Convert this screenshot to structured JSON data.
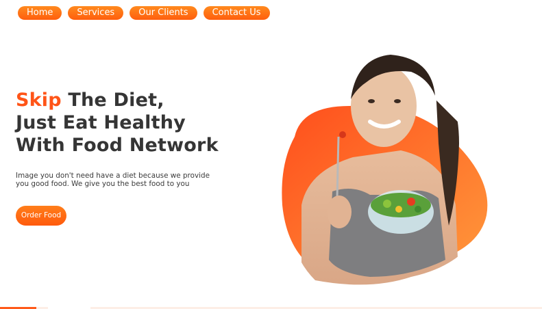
{
  "nav": {
    "items": [
      {
        "label": "Home"
      },
      {
        "label": "Services"
      },
      {
        "label": "Our Clients"
      },
      {
        "label": "Contact Us"
      }
    ]
  },
  "hero": {
    "title_accent": "Skip",
    "title_rest_line1": " The Diet,",
    "title_line2": "Just Eat Healthy",
    "title_line3": "With Food Network",
    "description": "Image you don't need have a diet because we provide you good food. We give you the best food to you",
    "cta_label": "Order Food"
  },
  "colors": {
    "accent": "#ff5417",
    "nav_gradient_top": "#ff8a1e",
    "nav_gradient_bottom": "#ff5e0e"
  },
  "icons": {
    "hero_image": "woman-eating-salad-illustration"
  }
}
